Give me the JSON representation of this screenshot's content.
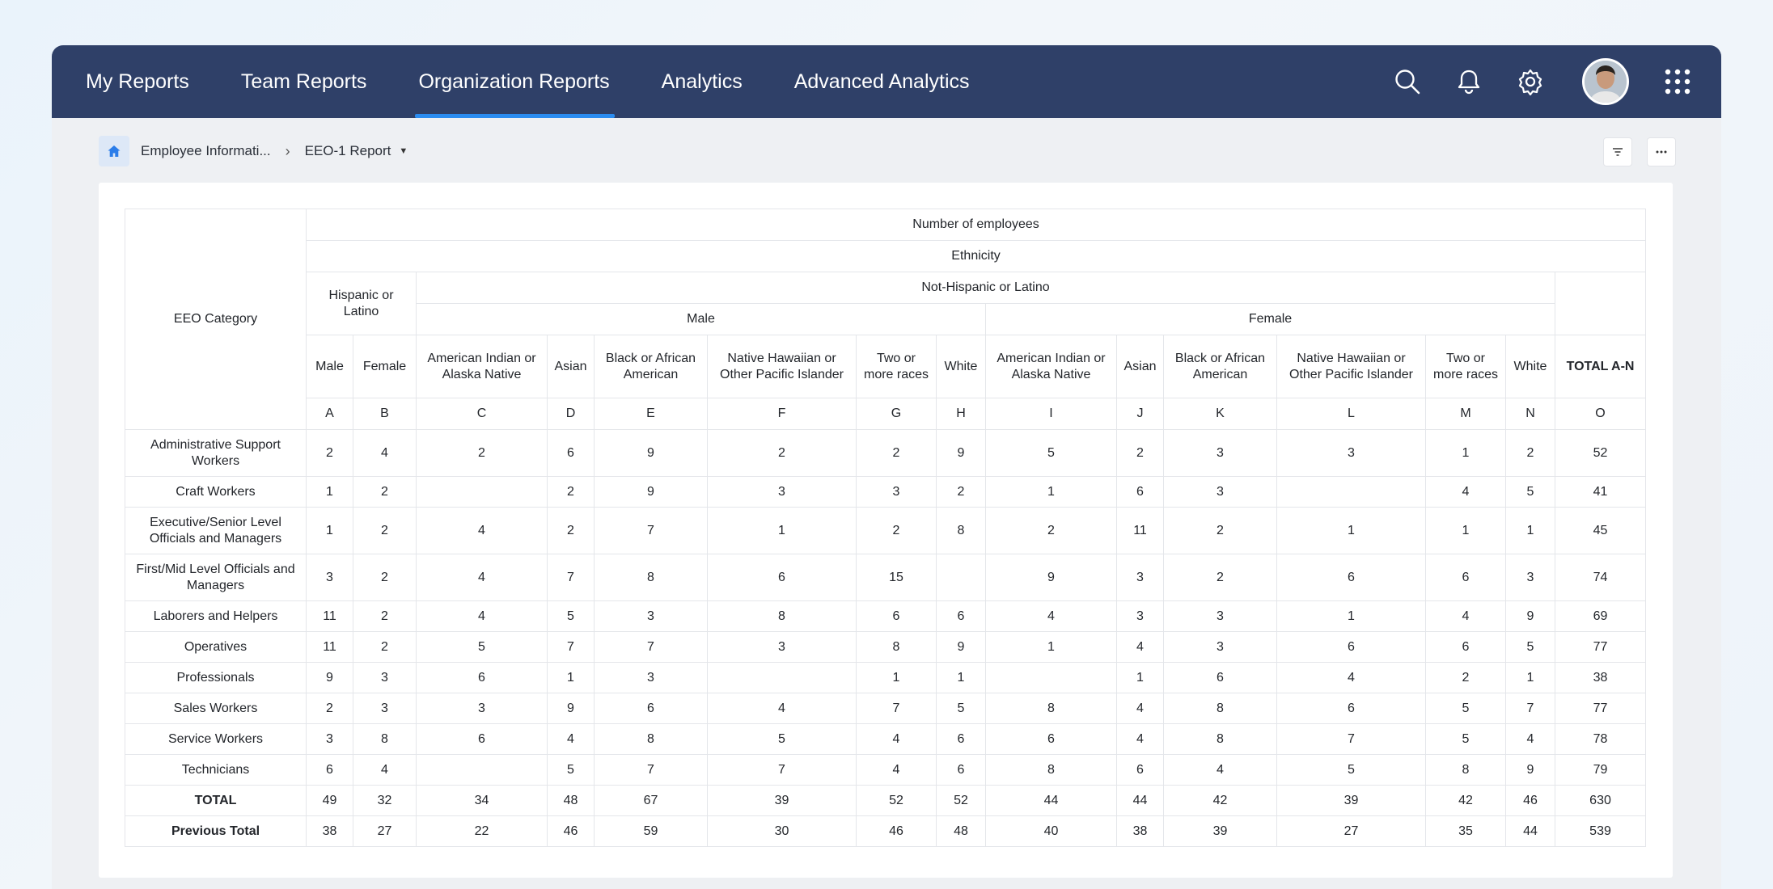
{
  "nav": {
    "tabs": [
      "My Reports",
      "Team Reports",
      "Organization Reports",
      "Analytics",
      "Advanced Analytics"
    ],
    "active_tab": "Organization Reports"
  },
  "breadcrumb": {
    "parent": "Employee Informati...",
    "current": "EEO-1 Report"
  },
  "table": {
    "category_header": "EEO Category",
    "number_header": "Number of employees",
    "ethnicity_header": "Ethnicity",
    "hispanic_header": "Hispanic or Latino",
    "not_hispanic_header": "Not-Hispanic or Latino",
    "male_header": "Male",
    "female_header": "Female",
    "columns": [
      "Male",
      "Female",
      "American Indian or Alaska Native",
      "Asian",
      "Black or African American",
      "Native Hawaiian or Other Pacific Islander",
      "Two or more races",
      "White",
      "American Indian or Alaska Native",
      "Asian",
      "Black or African American",
      "Native Hawaiian or Other Pacific Islander",
      "Two or more races",
      "White",
      "TOTAL A-N"
    ],
    "letters": [
      "A",
      "B",
      "C",
      "D",
      "E",
      "F",
      "G",
      "H",
      "I",
      "J",
      "K",
      "L",
      "M",
      "N",
      "O"
    ],
    "rows": [
      {
        "category": "Administrative Support Workers",
        "values": [
          "2",
          "4",
          "2",
          "6",
          "9",
          "2",
          "2",
          "9",
          "5",
          "2",
          "3",
          "3",
          "1",
          "2",
          "52"
        ]
      },
      {
        "category": "Craft Workers",
        "values": [
          "1",
          "2",
          "",
          "2",
          "9",
          "3",
          "3",
          "2",
          "1",
          "6",
          "3",
          "",
          "4",
          "5",
          "41"
        ]
      },
      {
        "category": "Executive/Senior Level Officials and Managers",
        "values": [
          "1",
          "2",
          "4",
          "2",
          "7",
          "1",
          "2",
          "8",
          "2",
          "11",
          "2",
          "1",
          "1",
          "1",
          "45"
        ]
      },
      {
        "category": "First/Mid Level Officials and Managers",
        "values": [
          "3",
          "2",
          "4",
          "7",
          "8",
          "6",
          "15",
          "",
          "9",
          "3",
          "2",
          "6",
          "6",
          "3",
          "74"
        ]
      },
      {
        "category": "Laborers and Helpers",
        "values": [
          "11",
          "2",
          "4",
          "5",
          "3",
          "8",
          "6",
          "6",
          "4",
          "3",
          "3",
          "1",
          "4",
          "9",
          "69"
        ]
      },
      {
        "category": "Operatives",
        "values": [
          "11",
          "2",
          "5",
          "7",
          "7",
          "3",
          "8",
          "9",
          "1",
          "4",
          "3",
          "6",
          "6",
          "5",
          "77"
        ]
      },
      {
        "category": "Professionals",
        "values": [
          "9",
          "3",
          "6",
          "1",
          "3",
          "",
          "1",
          "1",
          "",
          "1",
          "6",
          "4",
          "2",
          "1",
          "38"
        ]
      },
      {
        "category": "Sales Workers",
        "values": [
          "2",
          "3",
          "3",
          "9",
          "6",
          "4",
          "7",
          "5",
          "8",
          "4",
          "8",
          "6",
          "5",
          "7",
          "77"
        ]
      },
      {
        "category": "Service Workers",
        "values": [
          "3",
          "8",
          "6",
          "4",
          "8",
          "5",
          "4",
          "6",
          "6",
          "4",
          "8",
          "7",
          "5",
          "4",
          "78"
        ]
      },
      {
        "category": "Technicians",
        "values": [
          "6",
          "4",
          "",
          "5",
          "7",
          "7",
          "4",
          "6",
          "8",
          "6",
          "4",
          "5",
          "8",
          "9",
          "79"
        ]
      },
      {
        "category": "TOTAL",
        "bold": true,
        "values": [
          "49",
          "32",
          "34",
          "48",
          "67",
          "39",
          "52",
          "52",
          "44",
          "44",
          "42",
          "39",
          "42",
          "46",
          "630"
        ]
      },
      {
        "category": "Previous Total",
        "bold": true,
        "values": [
          "38",
          "27",
          "22",
          "46",
          "59",
          "30",
          "46",
          "48",
          "40",
          "38",
          "39",
          "27",
          "35",
          "44",
          "539"
        ]
      }
    ]
  }
}
